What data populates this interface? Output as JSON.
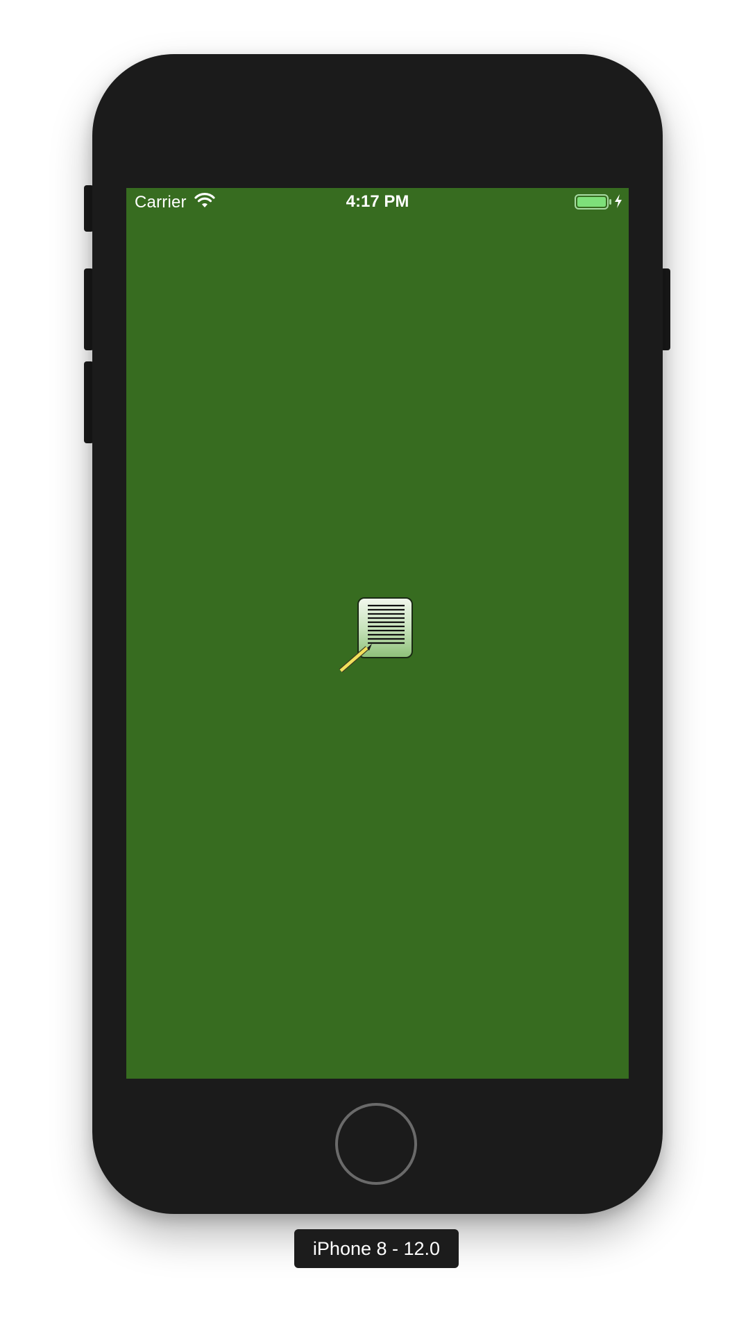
{
  "status_bar": {
    "carrier": "Carrier",
    "time": "4:17 PM",
    "wifi_icon": "wifi-icon",
    "battery_icon": "battery-charging-icon",
    "battery_level": 1.0,
    "charging": true
  },
  "screen": {
    "background_color": "#376c20",
    "app_icon": "notes-document-pencil-icon"
  },
  "device": {
    "label": "iPhone 8 - 12.0"
  },
  "colors": {
    "screen_bg": "#376c20",
    "bezel": "#1b1b1b",
    "battery_fill": "#7ee07a"
  }
}
